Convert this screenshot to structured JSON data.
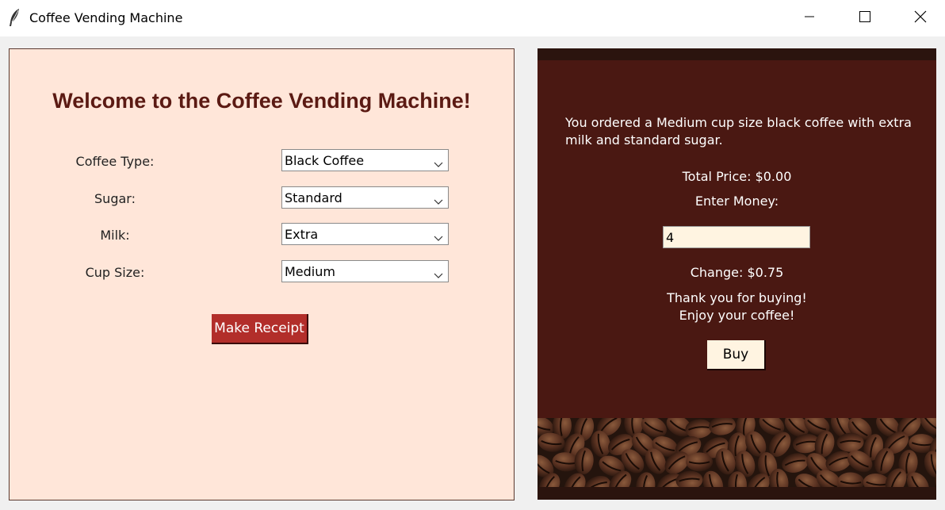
{
  "window": {
    "title": "Coffee Vending Machine",
    "icon": "feather-icon"
  },
  "left": {
    "heading": "Welcome to the Coffee Vending Machine!",
    "fields": [
      {
        "label": "Coffee Type:",
        "value": "Black Coffee"
      },
      {
        "label": "Sugar:",
        "value": "Standard"
      },
      {
        "label": "Milk:",
        "value": "Extra"
      },
      {
        "label": "Cup Size:",
        "value": "Medium"
      }
    ],
    "receipt_button": "Make Receipt"
  },
  "right": {
    "order_text": "You ordered a Medium cup size black coffee with extra milk and standard sugar.",
    "total_price": "Total Price: $0.00",
    "enter_money": "Enter Money:",
    "money_value": "4",
    "change": "Change: $0.75",
    "thanks_line1": "Thank you for buying!",
    "thanks_line2": "Enjoy your coffee!",
    "buy_button": "Buy",
    "image": "coffee-beans-image"
  },
  "colors": {
    "left_panel_bg": "#ffe6d9",
    "heading": "#5b1a13",
    "receipt_button_bg": "#b22e2a",
    "right_panel_bg": "#4a1812",
    "input_bg": "#fff4e1"
  }
}
